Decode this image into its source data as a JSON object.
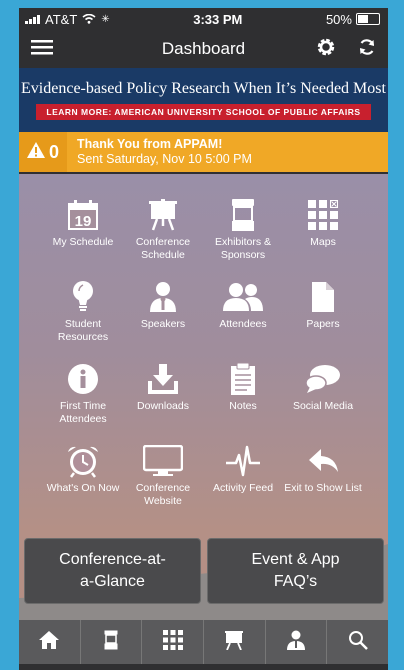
{
  "status": {
    "carrier": "AT&T",
    "time": "3:33 PM",
    "battery": "50%"
  },
  "navbar": {
    "title": "Dashboard"
  },
  "banner": {
    "headline": "Evidence-based Policy Research When It’s Needed Most",
    "cta": "LEARN MORE: AMERICAN UNIVERSITY SCHOOL OF PUBLIC AFFAIRS"
  },
  "alert": {
    "count": "0",
    "title": "Thank You from APPAM!",
    "subtitle": "Sent Saturday, Nov 10 5:00 PM"
  },
  "calendar_day": "19",
  "tiles": [
    {
      "label": "My Schedule",
      "icon": "calendar-icon"
    },
    {
      "label": "Conference Schedule",
      "icon": "easel-icon"
    },
    {
      "label": "Exhibitors & Sponsors",
      "icon": "booth-icon"
    },
    {
      "label": "Maps",
      "icon": "map-grid-icon"
    },
    {
      "label": "Student Resources",
      "icon": "lightbulb-icon"
    },
    {
      "label": "Speakers",
      "icon": "speaker-icon"
    },
    {
      "label": "Attendees",
      "icon": "people-icon"
    },
    {
      "label": "Papers",
      "icon": "document-icon"
    },
    {
      "label": "First Time Attendees",
      "icon": "info-icon"
    },
    {
      "label": "Downloads",
      "icon": "download-icon"
    },
    {
      "label": "Notes",
      "icon": "notepad-icon"
    },
    {
      "label": "Social Media",
      "icon": "chat-bubbles-icon"
    },
    {
      "label": "What's On Now",
      "icon": "alarm-clock-icon"
    },
    {
      "label": "Conference Website",
      "icon": "monitor-icon"
    },
    {
      "label": "Activity Feed",
      "icon": "pulse-icon"
    },
    {
      "label": "Exit to Show List",
      "icon": "back-arrow-icon"
    }
  ],
  "buttons": {
    "glance": "Conference-at-a-Glance",
    "faq": "Event & App FAQ’s"
  },
  "tabbar": [
    "home-icon",
    "booth-icon",
    "map-grid-icon",
    "easel-icon",
    "speaker-icon",
    "search-icon"
  ]
}
